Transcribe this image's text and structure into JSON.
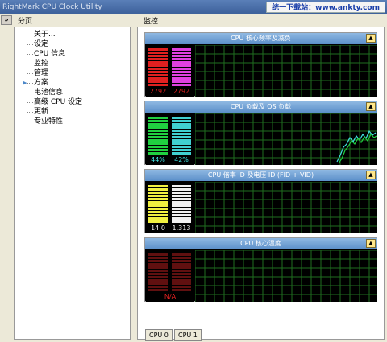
{
  "window": {
    "title": "RightMark CPU Clock Utility",
    "watermark": "统一下载站：www.ankty.com"
  },
  "left": {
    "collapse_glyph": "»",
    "title": "分页",
    "items": [
      "关于...",
      "设定",
      "CPU 信息",
      "监控",
      "管理",
      "方案",
      "电池信息",
      "高级 CPU 设定",
      "更新",
      "专业特性"
    ]
  },
  "right": {
    "title": "监控",
    "monitors": [
      {
        "title": "CPU 核心频率及减负",
        "value_a": "2792",
        "value_b": "2792",
        "color_a": "#e02020",
        "color_b": "#e040e0",
        "label_color": "#e02020",
        "trend": "none"
      },
      {
        "title": "CPU 负载及 OS 负载",
        "value_a": "44%",
        "value_b": "42%",
        "color_a": "#20d040",
        "color_b": "#40d0d0",
        "label_color": "#40e0e0",
        "trend": "load"
      },
      {
        "title": "CPU 倍率 ID 及电压 ID (FID + VID)",
        "value_a": "14.0",
        "value_b": "1.313",
        "color_a": "#f0f040",
        "color_b": "#f0f0f0",
        "label_color": "#f0f0f0",
        "trend": "none"
      },
      {
        "title": "CPU 核心温度",
        "value_a": "N/A",
        "value_b": "",
        "color_a": "#601010",
        "color_b": "#601010",
        "label_color": "#e02020",
        "trend": "none"
      }
    ],
    "header_button_glyph": "▲",
    "tabs": [
      "CPU 0",
      "CPU 1"
    ]
  },
  "colors": {
    "grid": "#1f6e1f",
    "trace_load": "#40e0e0",
    "trace_os": "#20d040"
  }
}
